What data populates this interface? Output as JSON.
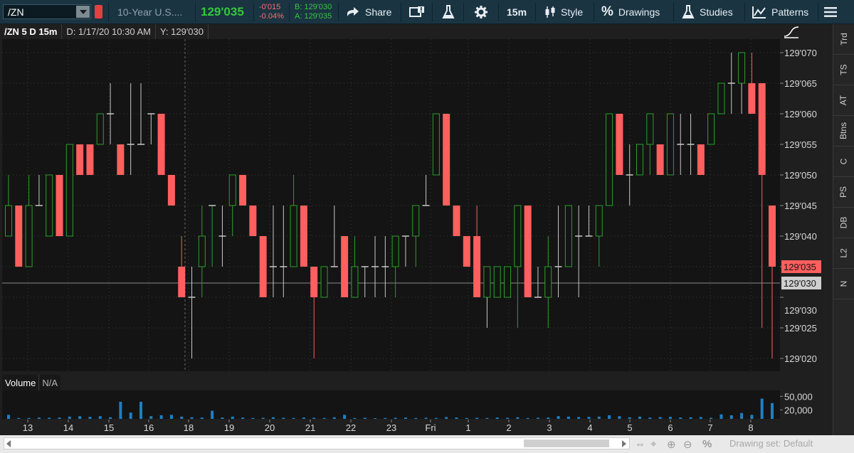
{
  "toolbar": {
    "symbol": "/ZN",
    "description": "10-Year U.S....",
    "last_price": "129'035",
    "net_change": "-0'015",
    "percent_change": "-0.04%",
    "bid": "B: 129'030",
    "ask": "A: 129'035",
    "share_label": "Share",
    "timeframe": "15m",
    "style_label": "Style",
    "drawings_label": "Drawings",
    "studies_label": "Studies",
    "patterns_label": "Patterns"
  },
  "chart_header": {
    "title": "/ZN 5 D 15m",
    "date_readout": "D: 1/17/20 10:30 AM",
    "y_readout": "Y: 129'030"
  },
  "price_axis": {
    "tick_labels": [
      "129'070",
      "129'065",
      "129'060",
      "129'055",
      "129'050",
      "129'045",
      "129'040",
      "129'035",
      "129'030",
      "129'025",
      "129'020"
    ],
    "last_price_label": "129'035",
    "crosshair_label": "129'030"
  },
  "volume": {
    "label": "Volume",
    "value": "N/A",
    "tick_labels": [
      "50,000",
      "20,000"
    ]
  },
  "time_axis": {
    "labels": [
      "13",
      "14",
      "15",
      "16",
      "18",
      "19",
      "20",
      "21",
      "22",
      "23",
      "Fri",
      "1",
      "2",
      "3",
      "4",
      "5",
      "6",
      "7",
      "8"
    ]
  },
  "right_tabs": [
    "Trd",
    "TS",
    "AT",
    "Btns",
    "C",
    "PS",
    "DB",
    "L2",
    "N"
  ],
  "bottom_bar": {
    "drawing_set": "Drawing set: Default"
  },
  "colors": {
    "up": "#2ca02c",
    "down": "#ff5f5f",
    "unchanged": "#c8c8c8",
    "volume": "#1e7fc2"
  },
  "chart_data": {
    "type": "candlestick",
    "price_unit": "thirty-seconds offset from 129'000 (tick labels show 129'020 to 129'070)",
    "ylim": [
      129.018,
      129.074
    ],
    "ohlc": [
      [
        45,
        50,
        40,
        40,
        "up"
      ],
      [
        45,
        45,
        35,
        35,
        "down"
      ],
      [
        35,
        50,
        35,
        45,
        "up"
      ],
      [
        45,
        50,
        45,
        45,
        "flat"
      ],
      [
        40,
        50,
        40,
        50,
        "up"
      ],
      [
        50,
        50,
        40,
        40,
        "down"
      ],
      [
        40,
        55,
        40,
        55,
        "up"
      ],
      [
        55,
        55,
        50,
        50,
        "down"
      ],
      [
        55,
        55,
        50,
        50,
        "down"
      ],
      [
        55,
        60,
        55,
        60,
        "up"
      ],
      [
        60,
        65,
        55,
        60,
        "flat"
      ],
      [
        55,
        55,
        50,
        50,
        "down"
      ],
      [
        55,
        65,
        50,
        55,
        "flat"
      ],
      [
        55,
        65,
        55,
        55,
        "flat"
      ],
      [
        60,
        60,
        55,
        60,
        "flat"
      ],
      [
        60,
        60,
        50,
        50,
        "down"
      ],
      [
        50,
        50,
        45,
        45,
        "down"
      ],
      [
        35,
        40,
        30,
        30,
        "down"
      ],
      [
        30,
        35,
        20,
        30,
        "flat"
      ],
      [
        35,
        45,
        30,
        40,
        "up"
      ],
      [
        45,
        45,
        35,
        45,
        "up"
      ],
      [
        40,
        45,
        35,
        40,
        "flat"
      ],
      [
        45,
        50,
        40,
        50,
        "up"
      ],
      [
        50,
        50,
        45,
        45,
        "down"
      ],
      [
        45,
        45,
        40,
        40,
        "down"
      ],
      [
        40,
        40,
        30,
        30,
        "down"
      ],
      [
        35,
        45,
        30,
        35,
        "flat"
      ],
      [
        35,
        45,
        30,
        35,
        "flat"
      ],
      [
        35,
        50,
        35,
        45,
        "up"
      ],
      [
        45,
        45,
        35,
        35,
        "down"
      ],
      [
        35,
        35,
        20,
        30,
        "down"
      ],
      [
        30,
        35,
        30,
        35,
        "up"
      ],
      [
        35,
        45,
        35,
        35,
        "flat"
      ],
      [
        40,
        40,
        30,
        30,
        "down"
      ],
      [
        30,
        40,
        30,
        35,
        "up"
      ],
      [
        35,
        35,
        30,
        35,
        "flat"
      ],
      [
        35,
        40,
        30,
        35,
        "flat"
      ],
      [
        35,
        40,
        30,
        35,
        "flat"
      ],
      [
        35,
        40,
        30,
        40,
        "up"
      ],
      [
        40,
        40,
        35,
        40,
        "flat"
      ],
      [
        40,
        45,
        35,
        45,
        "up"
      ],
      [
        45,
        50,
        45,
        45,
        "flat"
      ],
      [
        50,
        60,
        50,
        60,
        "up"
      ],
      [
        60,
        60,
        45,
        45,
        "down"
      ],
      [
        45,
        45,
        40,
        40,
        "down"
      ],
      [
        40,
        40,
        35,
        35,
        "down"
      ],
      [
        40,
        45,
        30,
        30,
        "down"
      ],
      [
        30,
        35,
        25,
        35,
        "flat"
      ],
      [
        35,
        35,
        30,
        30,
        "up"
      ],
      [
        30,
        35,
        30,
        35,
        "up"
      ],
      [
        35,
        45,
        25,
        45,
        "up"
      ],
      [
        45,
        45,
        30,
        30,
        "down"
      ],
      [
        30,
        35,
        30,
        30,
        "flat"
      ],
      [
        30,
        40,
        25,
        35,
        "up"
      ],
      [
        35,
        45,
        30,
        35,
        "flat"
      ],
      [
        35,
        45,
        35,
        45,
        "up"
      ],
      [
        40,
        45,
        30,
        40,
        "flat"
      ],
      [
        40,
        45,
        40,
        40,
        "flat"
      ],
      [
        40,
        45,
        35,
        45,
        "up"
      ],
      [
        45,
        60,
        45,
        60,
        "up"
      ],
      [
        60,
        60,
        50,
        50,
        "down"
      ],
      [
        50,
        55,
        45,
        50,
        "flat"
      ],
      [
        50,
        55,
        50,
        55,
        "up"
      ],
      [
        55,
        60,
        50,
        60,
        "up"
      ],
      [
        55,
        55,
        50,
        50,
        "down"
      ],
      [
        50,
        60,
        50,
        60,
        "up"
      ],
      [
        55,
        60,
        50,
        55,
        "flat"
      ],
      [
        55,
        60,
        50,
        55,
        "flat"
      ],
      [
        55,
        55,
        50,
        50,
        "down"
      ],
      [
        55,
        60,
        55,
        60,
        "up"
      ],
      [
        60,
        65,
        60,
        65,
        "up"
      ],
      [
        65,
        70,
        60,
        65,
        "flat"
      ],
      [
        65,
        70,
        60,
        70,
        "flat"
      ],
      [
        65,
        70,
        60,
        60,
        "down"
      ],
      [
        65,
        65,
        25,
        50,
        "down"
      ],
      [
        45,
        45,
        20,
        35,
        "down"
      ]
    ],
    "volume": [
      9000,
      2000,
      2000,
      3000,
      2500,
      3000,
      5000,
      6000,
      4500,
      6000,
      3500,
      38000,
      14000,
      38000,
      6000,
      8000,
      9000,
      5000,
      3500,
      3000,
      18000,
      3000,
      5000,
      3000,
      2000,
      2500,
      3500,
      2500,
      2000,
      3000,
      2500,
      2000,
      3500,
      9000,
      2000,
      2500,
      1500,
      2000,
      2500,
      3000,
      2000,
      2500,
      2000,
      4000,
      3000,
      2000,
      2500,
      2000,
      3000,
      2500,
      3500,
      2000,
      2500,
      3000,
      6000,
      5000,
      4000,
      4500,
      5000,
      8000,
      6000,
      3500,
      5000,
      3000,
      4000,
      4500,
      3000,
      3500,
      4000,
      2500,
      10000,
      8000,
      13000,
      9000,
      45000,
      35000
    ]
  }
}
